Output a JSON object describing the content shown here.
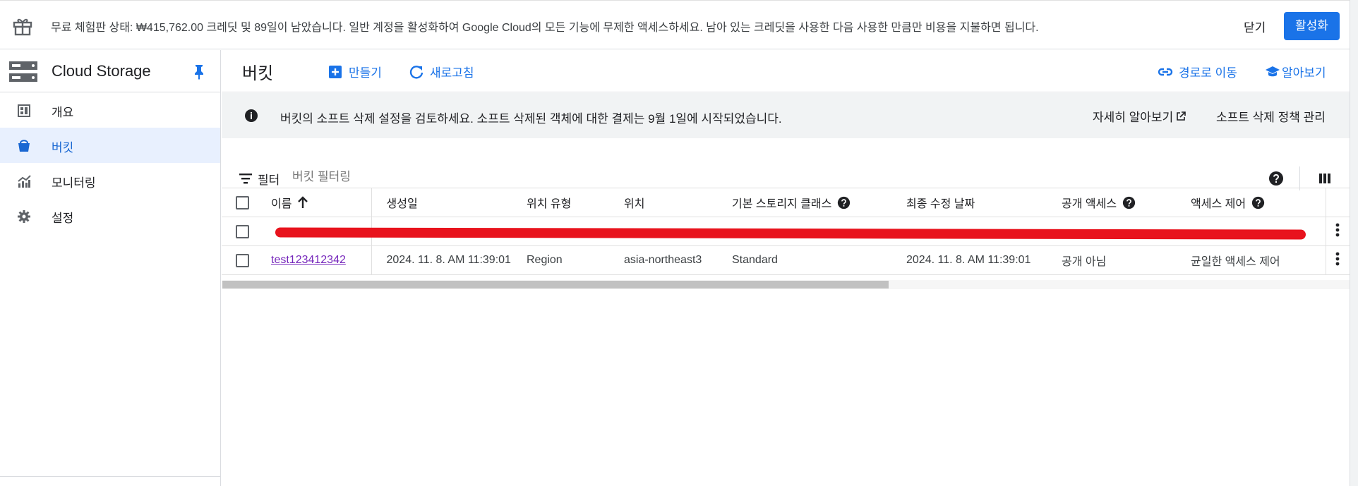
{
  "banner": {
    "message": "무료 체험판 상태: ₩415,762.00 크레딧 및 89일이 남았습니다. 일반 계정을 활성화하여 Google Cloud의 모든 기능에 무제한 액세스하세요. 남아 있는 크레딧을 사용한 다음 사용한 만큼만 비용을 지불하면 됩니다.",
    "close_label": "닫기",
    "activate_label": "활성화"
  },
  "sidebar": {
    "product_name": "Cloud Storage",
    "items": [
      {
        "label": "개요",
        "icon": "dashboard-icon"
      },
      {
        "label": "버킷",
        "icon": "bucket-icon"
      },
      {
        "label": "모니터링",
        "icon": "monitoring-icon"
      },
      {
        "label": "설정",
        "icon": "gear-icon"
      }
    ],
    "active_index": 1
  },
  "toolbar": {
    "title": "버킷",
    "create_label": "만들기",
    "refresh_label": "새로고침",
    "goto_path_label": "경로로 이동",
    "learn_label": "알아보기"
  },
  "notice": {
    "text": "버킷의 소프트 삭제 설정을 검토하세요. 소프트 삭제된 객체에 대한 결제는 9월 1일에 시작되었습니다.",
    "learn_more_label": "자세히 알아보기",
    "manage_label": "소프트 삭제 정책 관리"
  },
  "filter": {
    "label": "필터",
    "placeholder": "버킷 필터링"
  },
  "table": {
    "headers": {
      "name": "이름",
      "created": "생성일",
      "location_type": "위치 유형",
      "location": "위치",
      "storage_class": "기본 스토리지 클래스",
      "last_modified": "최종 수정 날짜",
      "public_access": "공개 액세스",
      "access_control": "액세스 제어"
    },
    "rows": [
      {
        "name": "",
        "created": "",
        "location_type": "",
        "location": "",
        "storage_class": "",
        "last_modified": "",
        "public_access": "",
        "access_control": ""
      },
      {
        "name": "test123412342",
        "created": "2024. 11. 8. AM 11:39:01",
        "location_type": "Region",
        "location": "asia-northeast3",
        "storage_class": "Standard",
        "last_modified": "2024. 11. 8. AM 11:39:01",
        "public_access": "공개 아님",
        "access_control": "균일한 액세스 제어"
      }
    ]
  },
  "colors": {
    "accent": "#1a73e8",
    "visited_link": "#7627bb",
    "redaction": "#e8131d"
  }
}
